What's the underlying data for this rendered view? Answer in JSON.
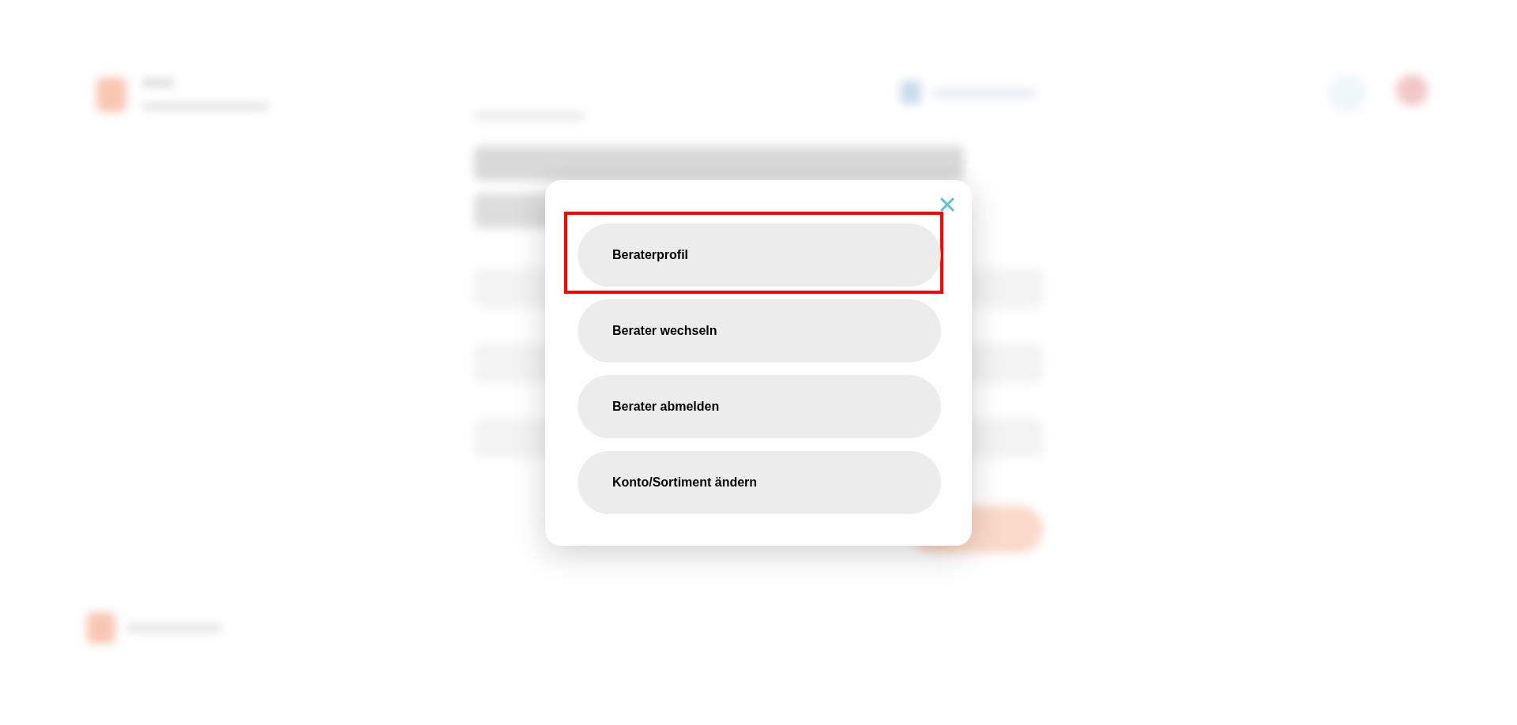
{
  "dialog": {
    "items": [
      {
        "label": "Beraterprofil",
        "highlighted": true
      },
      {
        "label": "Berater wechseln",
        "highlighted": false
      },
      {
        "label": "Berater abmelden",
        "highlighted": false
      },
      {
        "label": "Konto/Sortiment ändern",
        "highlighted": false
      }
    ]
  }
}
